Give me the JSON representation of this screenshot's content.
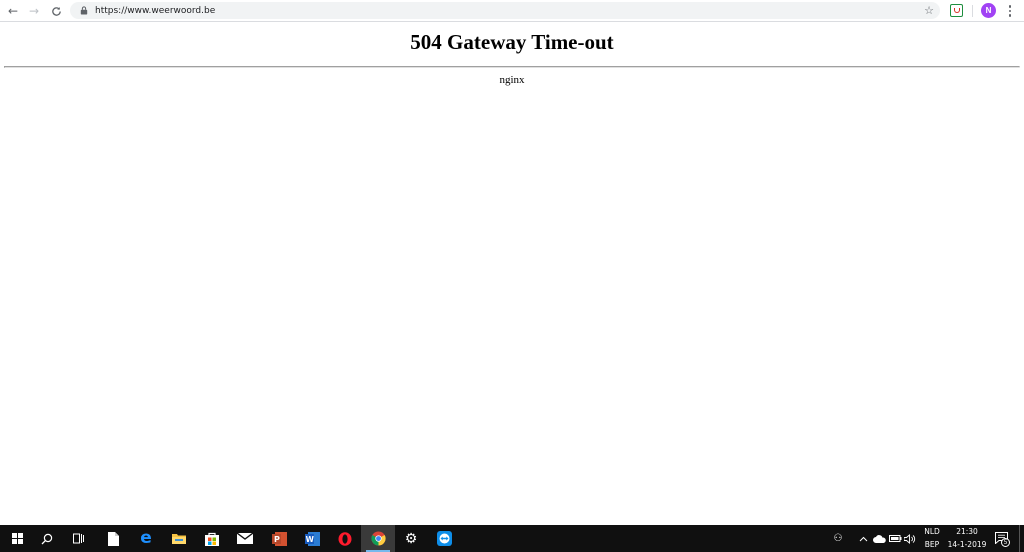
{
  "browser": {
    "url": "https://www.weerwoord.be",
    "back_label": "←",
    "forward_label": "→",
    "profile_initial": "N",
    "colors": {
      "profile": "#a142f4",
      "omnibox": "#f1f3f4"
    }
  },
  "page": {
    "title": "504 Gateway Time-out",
    "server": "nginx"
  },
  "taskbar": {
    "apps": [
      {
        "name": "start",
        "icon": "windows-logo-icon"
      },
      {
        "name": "search",
        "icon": "search-icon"
      },
      {
        "name": "task-view",
        "icon": "task-view-icon"
      },
      {
        "name": "file",
        "icon": "document-icon"
      },
      {
        "name": "edge",
        "icon": "edge-icon"
      },
      {
        "name": "file-explorer",
        "icon": "folder-icon"
      },
      {
        "name": "store",
        "icon": "store-icon"
      },
      {
        "name": "mail",
        "icon": "mail-icon"
      },
      {
        "name": "powerpoint",
        "icon": "powerpoint-icon",
        "letter": "P"
      },
      {
        "name": "word",
        "icon": "word-icon",
        "letter": "W"
      },
      {
        "name": "opera",
        "icon": "opera-icon"
      },
      {
        "name": "chrome",
        "icon": "chrome-icon",
        "active": true
      },
      {
        "name": "settings",
        "icon": "gear-icon"
      },
      {
        "name": "teamviewer",
        "icon": "teamviewer-icon"
      }
    ],
    "tray": {
      "language_top": "NLD",
      "language_bottom": "BEP",
      "time": "21:30",
      "date": "14-1-2019",
      "notification_count": "5"
    }
  }
}
